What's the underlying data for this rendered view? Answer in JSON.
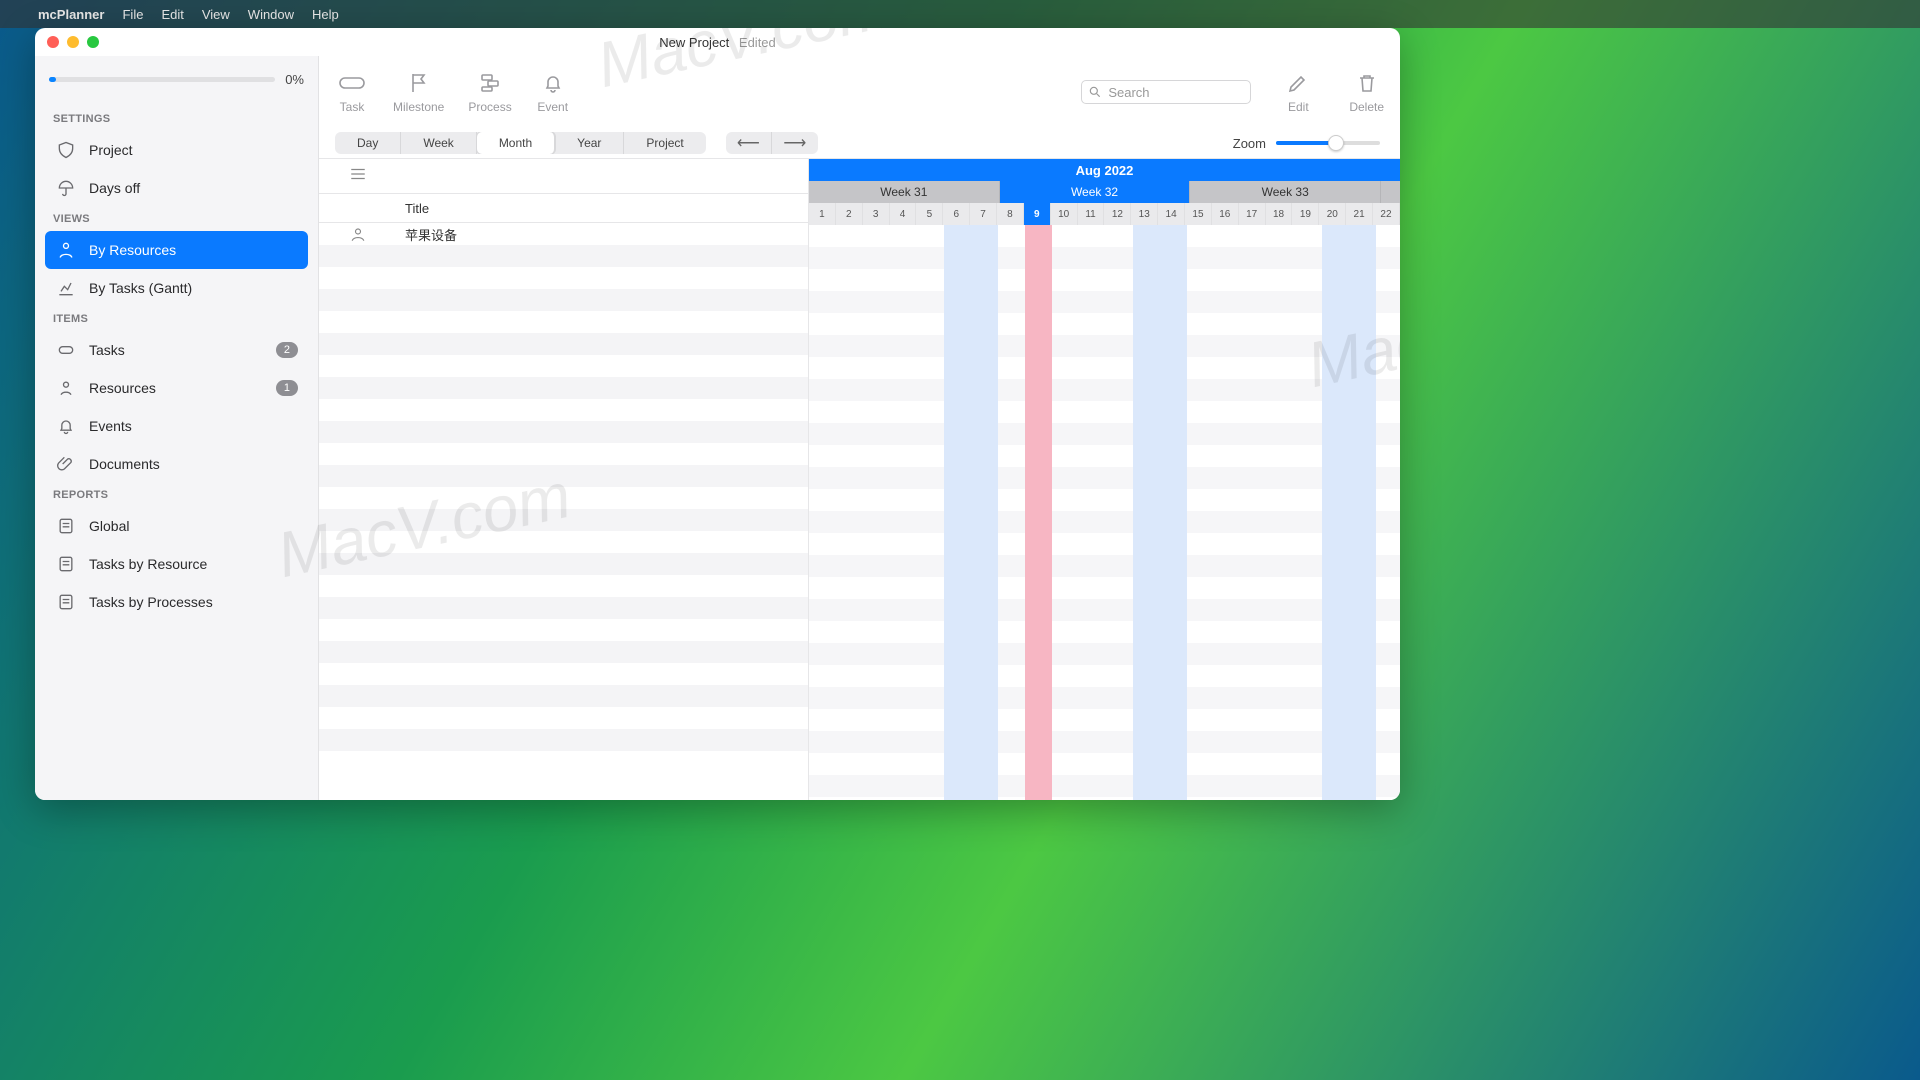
{
  "menubar": {
    "app": "mcPlanner",
    "items": [
      "File",
      "Edit",
      "View",
      "Window",
      "Help"
    ]
  },
  "window": {
    "title": "New Project",
    "edited": "Edited"
  },
  "sidebar": {
    "progress_pct": "0%",
    "sections": {
      "settings": "SETTINGS",
      "views": "VIEWS",
      "items": "ITEMS",
      "reports": "REPORTS"
    },
    "settings": {
      "project": "Project",
      "days_off": "Days off"
    },
    "views": {
      "by_resources": "By Resources",
      "by_tasks_gantt": "By Tasks (Gantt)"
    },
    "items": {
      "tasks": "Tasks",
      "tasks_count": "2",
      "resources": "Resources",
      "resources_count": "1",
      "events": "Events",
      "documents": "Documents"
    },
    "reports": {
      "global": "Global",
      "by_resource": "Tasks by Resource",
      "by_processes": "Tasks by Processes"
    }
  },
  "toolbar": {
    "task": "Task",
    "milestone": "Milestone",
    "process": "Process",
    "event": "Event",
    "search_placeholder": "Search",
    "edit": "Edit",
    "delete": "Delete"
  },
  "timescale": {
    "options": [
      "Day",
      "Week",
      "Month",
      "Year",
      "Project"
    ],
    "active": "Month"
  },
  "zoom_label": "Zoom",
  "list": {
    "title_header": "Title",
    "rows": [
      {
        "title": "苹果设备"
      }
    ]
  },
  "timeline": {
    "month_label": "Aug 2022",
    "weeks": [
      "Week 31",
      "Week 32",
      "Week 33"
    ],
    "active_week_index": 1,
    "days": [
      "1",
      "2",
      "3",
      "4",
      "5",
      "6",
      "7",
      "8",
      "9",
      "10",
      "11",
      "12",
      "13",
      "14",
      "15",
      "16",
      "17",
      "18",
      "19",
      "20",
      "21",
      "22"
    ],
    "today_index": 8,
    "weekend_indices": [
      [
        5,
        6
      ],
      [
        12,
        13
      ],
      [
        19,
        20
      ]
    ]
  },
  "watermark": "MacV.com"
}
